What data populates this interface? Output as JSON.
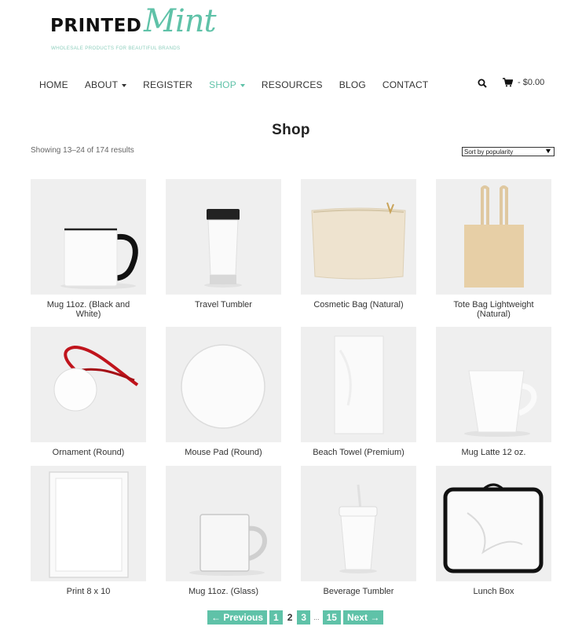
{
  "brand": {
    "logo_main": "PRINTED",
    "logo_script": "Mint",
    "tagline": "WHOLESALE PRODUCTS FOR BEAUTIFUL BRANDS",
    "accent_color": "#5fc2a8"
  },
  "nav": {
    "items": [
      {
        "label": "HOME"
      },
      {
        "label": "ABOUT"
      },
      {
        "label": "REGISTER"
      },
      {
        "label": "SHOP"
      },
      {
        "label": "RESOURCES"
      },
      {
        "label": "BLOG"
      },
      {
        "label": "CONTACT"
      }
    ],
    "active": "SHOP",
    "cart_total": "- $0.00"
  },
  "shop": {
    "title": "Shop",
    "result_count": "Showing 13–24 of 174 results",
    "sort_selected": "Sort by popularity"
  },
  "products": [
    {
      "name": "Mug 11oz. (Black and White)",
      "icon": "mug-icon"
    },
    {
      "name": "Travel Tumbler",
      "icon": "tumbler-icon"
    },
    {
      "name": "Cosmetic Bag (Natural)",
      "icon": "cosmetic-bag-icon"
    },
    {
      "name": "Tote Bag Lightweight (Natural)",
      "icon": "tote-bag-icon"
    },
    {
      "name": "Ornament (Round)",
      "icon": "ornament-icon"
    },
    {
      "name": "Mouse Pad (Round)",
      "icon": "mouse-pad-icon"
    },
    {
      "name": "Beach Towel (Premium)",
      "icon": "towel-icon"
    },
    {
      "name": "Mug Latte 12 oz.",
      "icon": "latte-mug-icon"
    },
    {
      "name": "Print 8 x 10",
      "icon": "print-frame-icon"
    },
    {
      "name": "Mug 11oz. (Glass)",
      "icon": "glass-mug-icon"
    },
    {
      "name": "Beverage Tumbler",
      "icon": "beverage-tumbler-icon"
    },
    {
      "name": "Lunch Box",
      "icon": "lunch-box-icon"
    }
  ],
  "pagination": {
    "previous": "← Previous",
    "page_1": "1",
    "current": "2",
    "page_3": "3",
    "dots": "...",
    "last": "15",
    "next": "Next →"
  }
}
